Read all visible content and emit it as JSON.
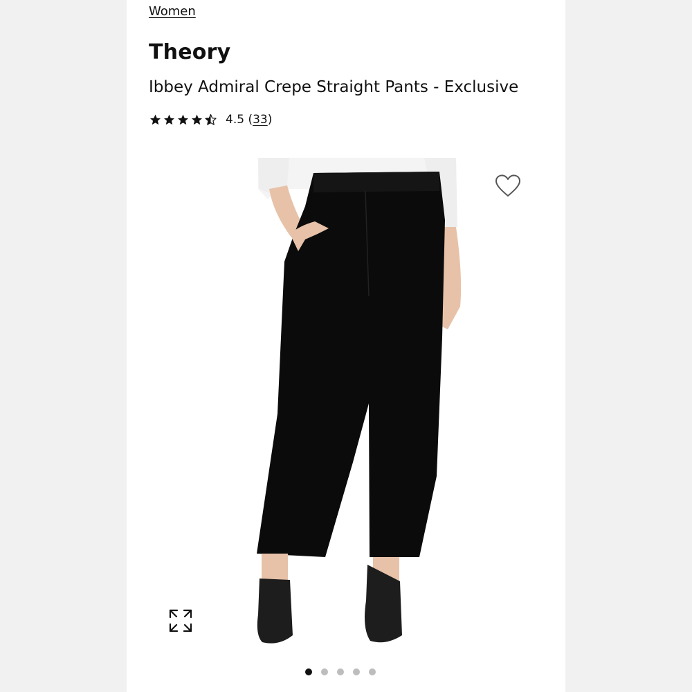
{
  "breadcrumb": {
    "label": "Women"
  },
  "product": {
    "brand": "Theory",
    "title": "Ibbey Admiral Crepe Straight Pants - Exclusive",
    "rating": {
      "value": "4.5",
      "count": "33",
      "stars": 4.5
    }
  },
  "image": {
    "alt": "Model wearing black straight pants with white shirt and black heels",
    "colors": {
      "pants": "#0b0b0b",
      "shirt": "#f4f4f4",
      "skin": "#e7c2a8",
      "shoes": "#1d1d1d"
    }
  },
  "icons": {
    "wishlist": "heart-outline-icon",
    "expand": "expand-icon"
  },
  "carousel": {
    "count": 5,
    "active_index": 0
  }
}
